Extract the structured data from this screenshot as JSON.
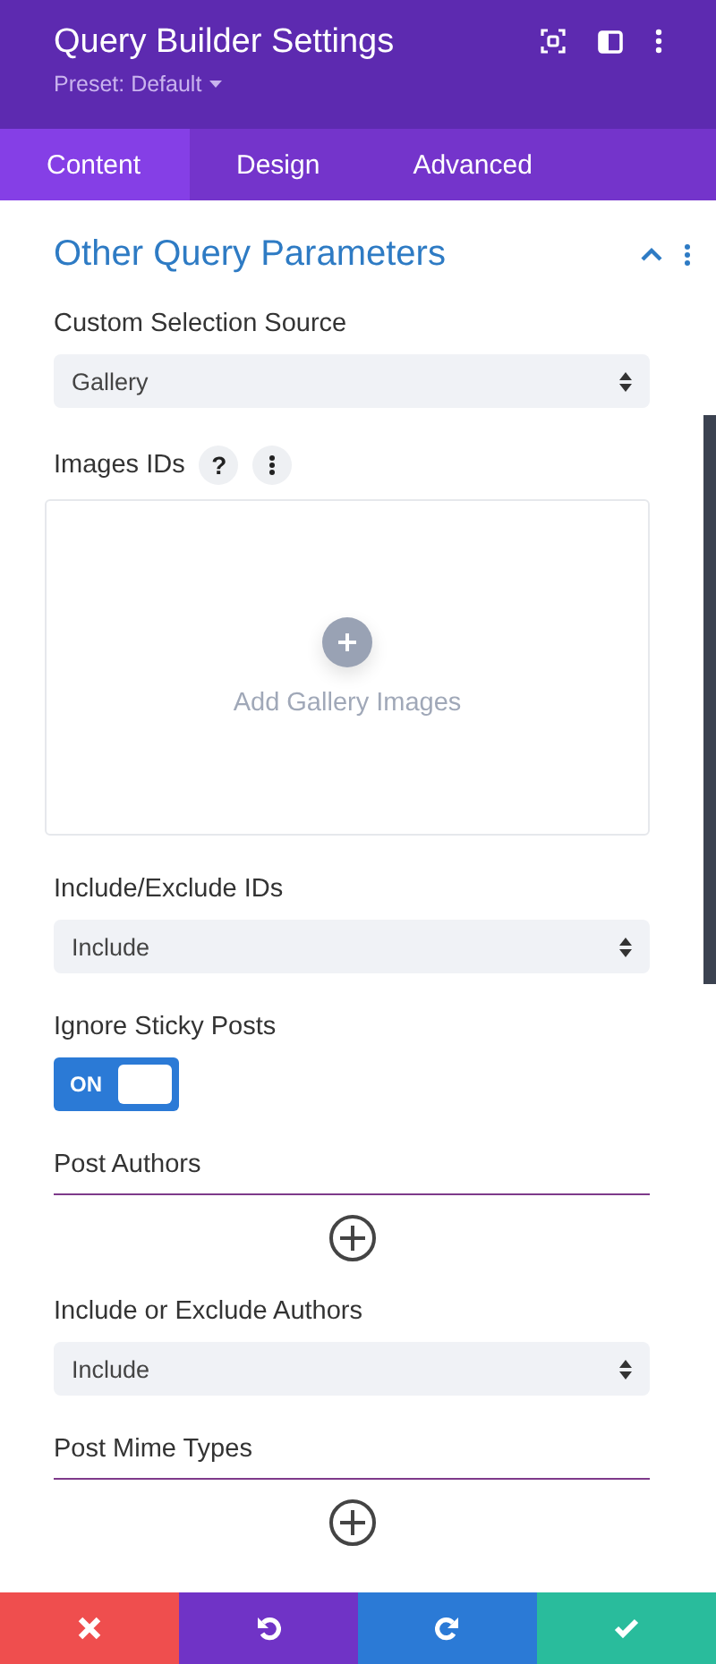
{
  "header": {
    "title": "Query Builder Settings",
    "preset": "Preset: Default"
  },
  "tabs": [
    {
      "label": "Content",
      "selected": true
    },
    {
      "label": "Design",
      "selected": false
    },
    {
      "label": "Advanced",
      "selected": false
    }
  ],
  "section": {
    "title": "Other Query Parameters",
    "expanded": true
  },
  "fields": [
    {
      "kind": "select",
      "label": "Custom Selection Source",
      "value": "Gallery"
    },
    {
      "kind": "gallery",
      "label": "Images IDs",
      "help": "?",
      "add_label": "Add Gallery Images"
    },
    {
      "kind": "select",
      "label": "Include/Exclude IDs",
      "value": "Include"
    },
    {
      "kind": "toggle",
      "label": "Ignore Sticky Posts",
      "on": true,
      "state_label": "ON"
    },
    {
      "kind": "repeater",
      "label": "Post Authors"
    },
    {
      "kind": "select",
      "label": "Include or Exclude Authors",
      "value": "Include"
    },
    {
      "kind": "repeater",
      "label": "Post Mime Types"
    }
  ],
  "footer": [
    {
      "kind": "cancel"
    },
    {
      "kind": "undo"
    },
    {
      "kind": "redo"
    },
    {
      "kind": "save"
    }
  ]
}
